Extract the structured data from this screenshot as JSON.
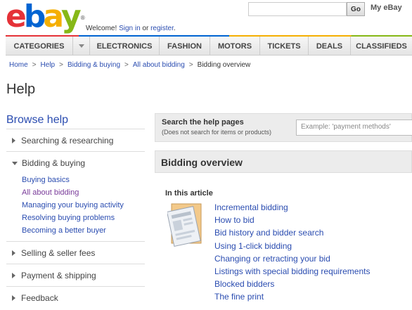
{
  "header": {
    "logo_letters": [
      "e",
      "b",
      "a",
      "y"
    ],
    "logo_reg": "®",
    "welcome_prefix": "Welcome! ",
    "sign_in": "Sign in",
    "or_text": " or ",
    "register": "register",
    "period": ".",
    "go_label": "Go",
    "myebay_label": "My eBay",
    "search_value": ""
  },
  "nav": {
    "items": [
      "CATEGORIES",
      "ELECTRONICS",
      "FASHION",
      "MOTORS",
      "TICKETS",
      "DEALS",
      "CLASSIFIEDS"
    ]
  },
  "breadcrumb": [
    "Home",
    "Help",
    "Bidding & buying",
    "All about bidding",
    "Bidding overview"
  ],
  "breadcrumb_sep": ">",
  "page_title": "Help",
  "sidebar": {
    "title": "Browse help",
    "sections": [
      {
        "label": "Searching & researching"
      },
      {
        "label": "Bidding & buying",
        "expanded": true,
        "items": [
          "Buying basics",
          "All about bidding",
          "Managing your buying activity",
          "Resolving buying problems",
          "Becoming a better buyer"
        ]
      },
      {
        "label": "Selling & seller fees"
      },
      {
        "label": "Payment & shipping"
      },
      {
        "label": "Feedback"
      }
    ]
  },
  "search_help": {
    "title": "Search the help pages",
    "note": "(Does not search for items or products)",
    "placeholder": "Example: 'payment methods'"
  },
  "overview": {
    "title": "Bidding overview",
    "in_article": "In this article",
    "links": [
      "Incremental bidding",
      "How to bid",
      "Bid history and bidder search",
      "Using 1-click bidding",
      "Changing or retracting your bid",
      "Listings with special bidding requirements",
      "Blocked bidders",
      "The fine print"
    ]
  },
  "colors": {
    "link": "#2a4cb0",
    "visited": "#7a3c9a",
    "logo_red": "#e53238",
    "logo_blue": "#0064d2",
    "logo_yellow": "#f5af02",
    "logo_green": "#86b817"
  },
  "icons": [
    "chevron-down-icon",
    "triangle-right-icon",
    "triangle-down-icon",
    "document-icon"
  ]
}
